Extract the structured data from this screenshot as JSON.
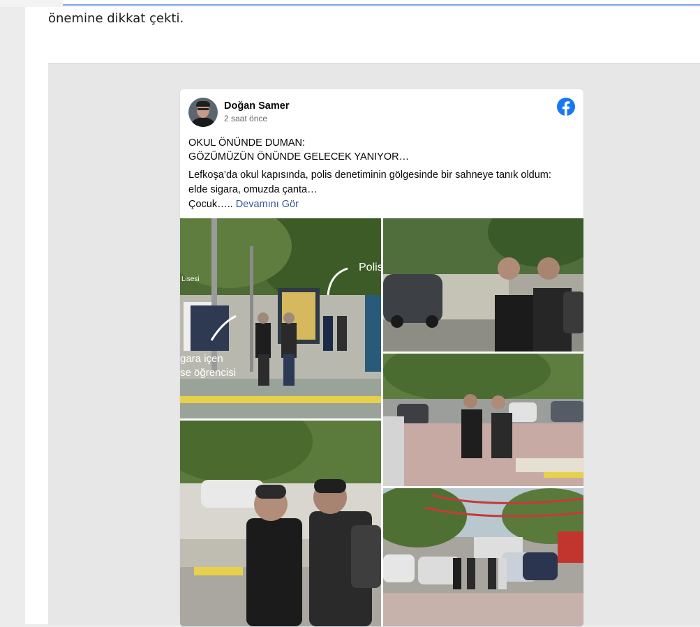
{
  "article": {
    "text_fragment": "önemine dikkat çekti."
  },
  "post": {
    "author": "Doğan Samer",
    "time": "2 saat önce",
    "title_line1": "OKUL ÖNÜNDE DUMAN:",
    "title_line2": "GÖZÜMÜZÜN ÖNÜNDE GELECEK YANIYOR…",
    "body_line1": "Lefkoşa’da okul kapısında, polis denetiminin gölgesinde bir sahneye tanık oldum:",
    "body_line2": "elde sigara, omuzda çanta…",
    "body_line3": "Çocuk…..",
    "see_more": "Devamını Gör"
  },
  "photo1_overlay": {
    "label_polis": "Polis",
    "label_lisesi": "Lisesi",
    "label_caption_1": "gara içen",
    "label_caption_2": "se öğrencisi"
  },
  "icons": {
    "platform": "facebook-icon"
  },
  "colors": {
    "facebook_blue": "#1877f2",
    "link_blue": "#385898",
    "page_bg": "#ececec",
    "embed_bg": "#e7e7e7"
  }
}
